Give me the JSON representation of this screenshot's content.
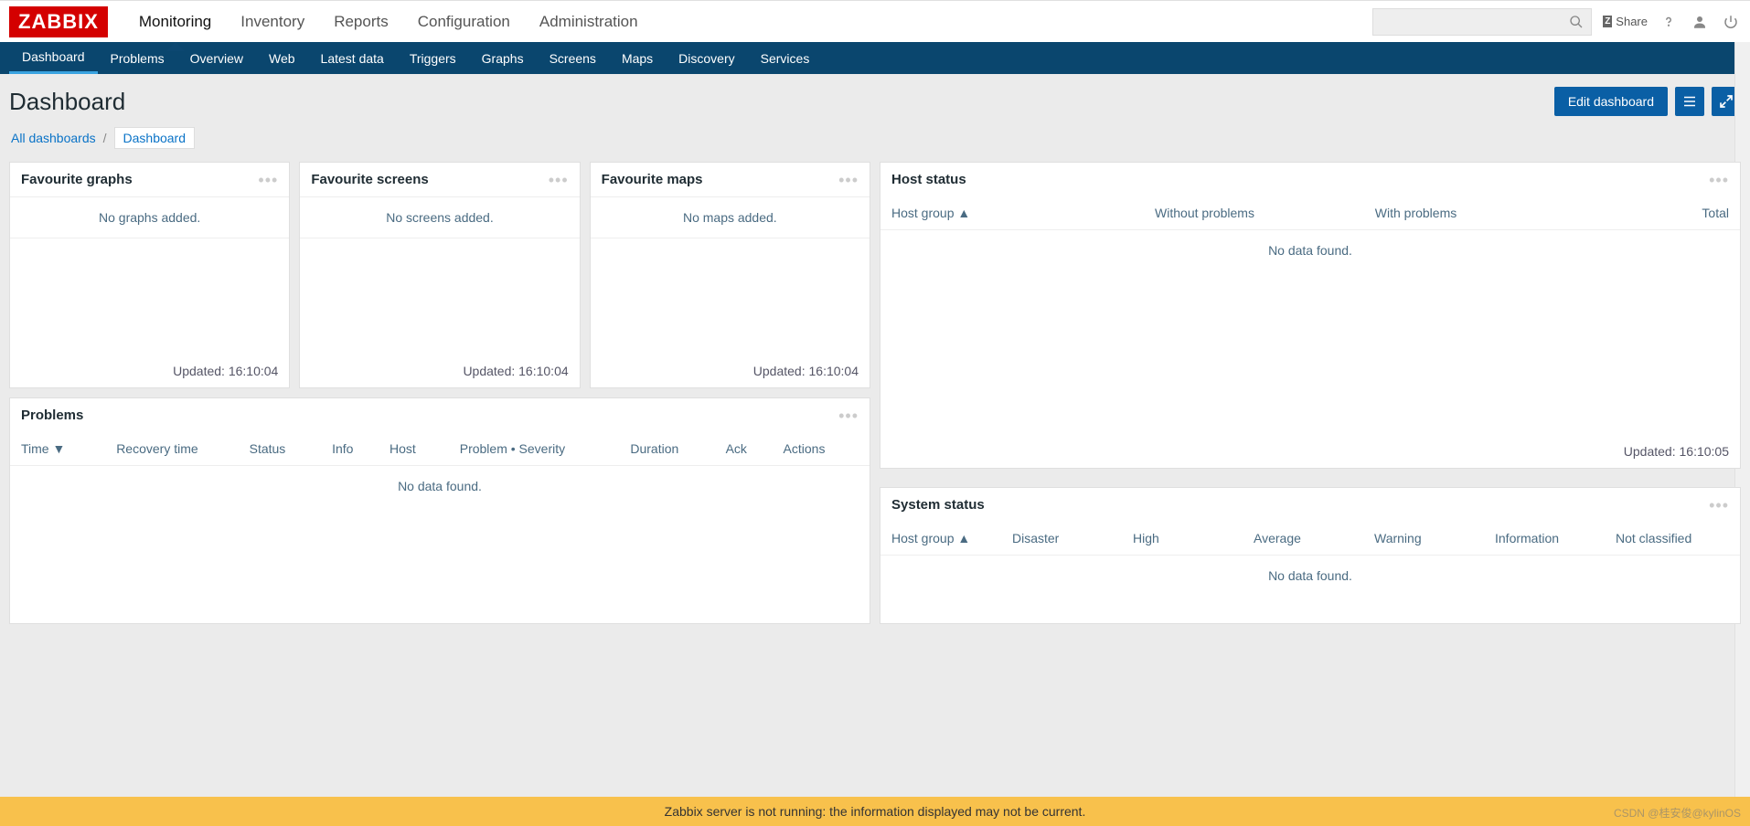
{
  "logo": "ZABBIX",
  "mainnav": [
    "Monitoring",
    "Inventory",
    "Reports",
    "Configuration",
    "Administration"
  ],
  "mainnav_active": 0,
  "share_label": "Share",
  "subnav": [
    "Dashboard",
    "Problems",
    "Overview",
    "Web",
    "Latest data",
    "Triggers",
    "Graphs",
    "Screens",
    "Maps",
    "Discovery",
    "Services"
  ],
  "subnav_active": 0,
  "page_title": "Dashboard",
  "edit_btn": "Edit dashboard",
  "breadcrumb": {
    "root": "All dashboards",
    "current": "Dashboard"
  },
  "widgets": {
    "fav_graphs": {
      "title": "Favourite graphs",
      "empty": "No graphs added.",
      "updated": "Updated: 16:10:04"
    },
    "fav_screens": {
      "title": "Favourite screens",
      "empty": "No screens added.",
      "updated": "Updated: 16:10:04"
    },
    "fav_maps": {
      "title": "Favourite maps",
      "empty": "No maps added.",
      "updated": "Updated: 16:10:04"
    },
    "host_status": {
      "title": "Host status",
      "cols": [
        "Host group",
        "Without problems",
        "With problems",
        "Total"
      ],
      "sort_indicator": "▲",
      "no_data": "No data found.",
      "updated": "Updated: 16:10:05"
    },
    "problems": {
      "title": "Problems",
      "cols": [
        "Time",
        "Recovery time",
        "Status",
        "Info",
        "Host",
        "Problem • Severity",
        "Duration",
        "Ack",
        "Actions"
      ],
      "sort_indicator": "▼",
      "no_data": "No data found."
    },
    "system_status": {
      "title": "System status",
      "cols": [
        "Host group",
        "Disaster",
        "High",
        "Average",
        "Warning",
        "Information",
        "Not classified"
      ],
      "sort_indicator": "▲",
      "no_data": "No data found."
    }
  },
  "warning": "Zabbix server is not running: the information displayed may not be current.",
  "watermark": "CSDN @桂安俊@kylinOS"
}
